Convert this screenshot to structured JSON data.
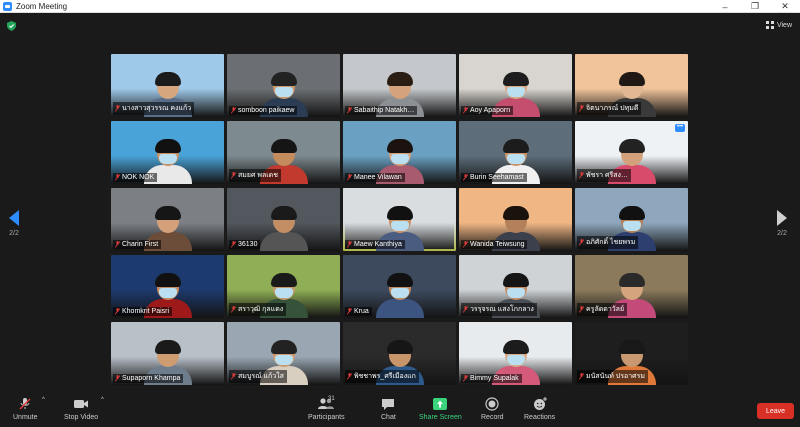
{
  "window": {
    "title": "Zoom Meeting",
    "minimize": "–",
    "maximize": "❐",
    "close": "✕"
  },
  "header": {
    "view_label": "View",
    "icon": "grid-icon",
    "security_icon": "shield-check-icon"
  },
  "pager": {
    "left": "2/2",
    "right": "2/2"
  },
  "participants": [
    {
      "name": "นางสาวสุวรรณ คงแก้ว",
      "bg": "#9ec9e8",
      "skin": "#d7a77f",
      "hair": "#1b1b1b",
      "body": "#5a6e8a",
      "mask": false
    },
    {
      "name": "somboon paikaew",
      "bg": "#6b6f73",
      "skin": "#c9986d",
      "hair": "#222",
      "body": "#2b3d55",
      "mask": true
    },
    {
      "name": "Sabaithip Natakh…",
      "bg": "#c4c8cc",
      "skin": "#d4a27c",
      "hair": "#2a1d14",
      "body": "#8c8f94",
      "mask": false
    },
    {
      "name": "Aoy Apaporn",
      "bg": "#d8d4cf",
      "skin": "#d9aa86",
      "hair": "#1d1d1d",
      "body": "#c54d6e",
      "mask": true
    },
    {
      "name": "จิตนาภรณ์ ปทุมดี",
      "bg": "#f0c39a",
      "skin": "#e2b894",
      "hair": "#201814",
      "body": "#3a3a3a",
      "mask": false
    },
    {
      "name": "NOK NOK",
      "bg": "#4aa3d8",
      "skin": "#c78f62",
      "hair": "#111",
      "body": "#e9e9e9",
      "mask": true
    },
    {
      "name": "สมยศ พลเดช",
      "bg": "#7d8a8f",
      "skin": "#c48b5d",
      "hair": "#151515",
      "body": "#c23a2d",
      "mask": false
    },
    {
      "name": "Manee Vilawan",
      "bg": "#6aa0c2",
      "skin": "#d5a078",
      "hair": "#1b1310",
      "body": "#a85a6e",
      "mask": true
    },
    {
      "name": "Burin Seehamast",
      "bg": "#5d6d7a",
      "skin": "#c99469",
      "hair": "#1c1c1c",
      "body": "#f0f0f0",
      "mask": true
    },
    {
      "name": "พัชรา ศรีสง…",
      "bg": "#eef2f5",
      "skin": "#d2a07a",
      "hair": "#222",
      "body": "#d94b6a",
      "mask": false
    },
    {
      "name": "Charin First",
      "bg": "#7c8085",
      "skin": "#d4a07a",
      "hair": "#161616",
      "body": "#6b4d3a",
      "mask": false
    },
    {
      "name": "36130",
      "bg": "#53585e",
      "skin": "#c38e64",
      "hair": "#1a1a1a",
      "body": "#555",
      "mask": false
    },
    {
      "name": "Maew Kanthiya",
      "bg": "#d9dde0",
      "skin": "#c99066",
      "hair": "#111",
      "body": "#4a5c80",
      "mask": true
    },
    {
      "name": "Wanida Teiwsung",
      "bg": "#f0b784",
      "skin": "#b4805c",
      "hair": "#1a120c",
      "body": "#3c3f4c",
      "mask": false
    },
    {
      "name": "อภิศักดิ์ ไชยพรม",
      "bg": "#8ea7bd",
      "skin": "#b57f57",
      "hair": "#111",
      "body": "#2c3f6e",
      "mask": true
    },
    {
      "name": "Khomkrit Paisri",
      "bg": "#1d3a6e",
      "skin": "#c48c61",
      "hair": "#111",
      "body": "#9e1a1a",
      "mask": true
    },
    {
      "name": "สราวุฒิ กุลแดง",
      "bg": "#8fae55",
      "skin": "#c79a6d",
      "hair": "#1a1a1a",
      "body": "#36523a",
      "mask": true
    },
    {
      "name": "Krua",
      "bg": "#3d4a5e",
      "skin": "#c18a60",
      "hair": "#111",
      "body": "#3b5580",
      "mask": true
    },
    {
      "name": "วรรุจรณ แสงโกกลาง",
      "bg": "#cfd3d6",
      "skin": "#c28c64",
      "hair": "#151515",
      "body": "#4a4e55",
      "mask": true
    },
    {
      "name": "ครูลัดดาวัลย์",
      "bg": "#8b7a5c",
      "skin": "#d4a47e",
      "hair": "#2a2a2a",
      "body": "#c44a7a",
      "mask": false
    },
    {
      "name": "Supaporn Khampa",
      "bg": "#b8c0c8",
      "skin": "#cf9c72",
      "hair": "#1a1a1a",
      "body": "#6d7d8c",
      "mask": false
    },
    {
      "name": "สมบูรณ์ แก้วใส",
      "bg": "#9aa7b3",
      "skin": "#cc9a70",
      "hair": "#222",
      "body": "#d9cfc0",
      "mask": true
    },
    {
      "name": "พิชชาพร_ศรีเมืองแก",
      "bg": "#2a2a2a",
      "skin": "#c8956a",
      "hair": "#161616",
      "body": "#2e5a8c",
      "mask": false
    },
    {
      "name": "Bimmy Supalak",
      "bg": "#e8ebee",
      "skin": "#d9ac88",
      "hair": "#1c1c1c",
      "body": "#d45a7a",
      "mask": true
    },
    {
      "name": "มนัสนันท์ ปรอาศรม",
      "bg": "#1e1e1e",
      "skin": "#c89870",
      "hair": "#181818",
      "body": "#e07a3a",
      "mask": false
    }
  ],
  "toolbar": {
    "unmute": "Unmute",
    "stop_video": "Stop Video",
    "participants": "Participants",
    "participants_count": "31",
    "chat": "Chat",
    "share_screen": "Share Screen",
    "record": "Record",
    "reactions": "Reactions",
    "leave": "Leave"
  },
  "colors": {
    "accent": "#2d8cff",
    "share": "#39d47c",
    "leave": "#d93025",
    "active_speaker": "#e6f260"
  }
}
